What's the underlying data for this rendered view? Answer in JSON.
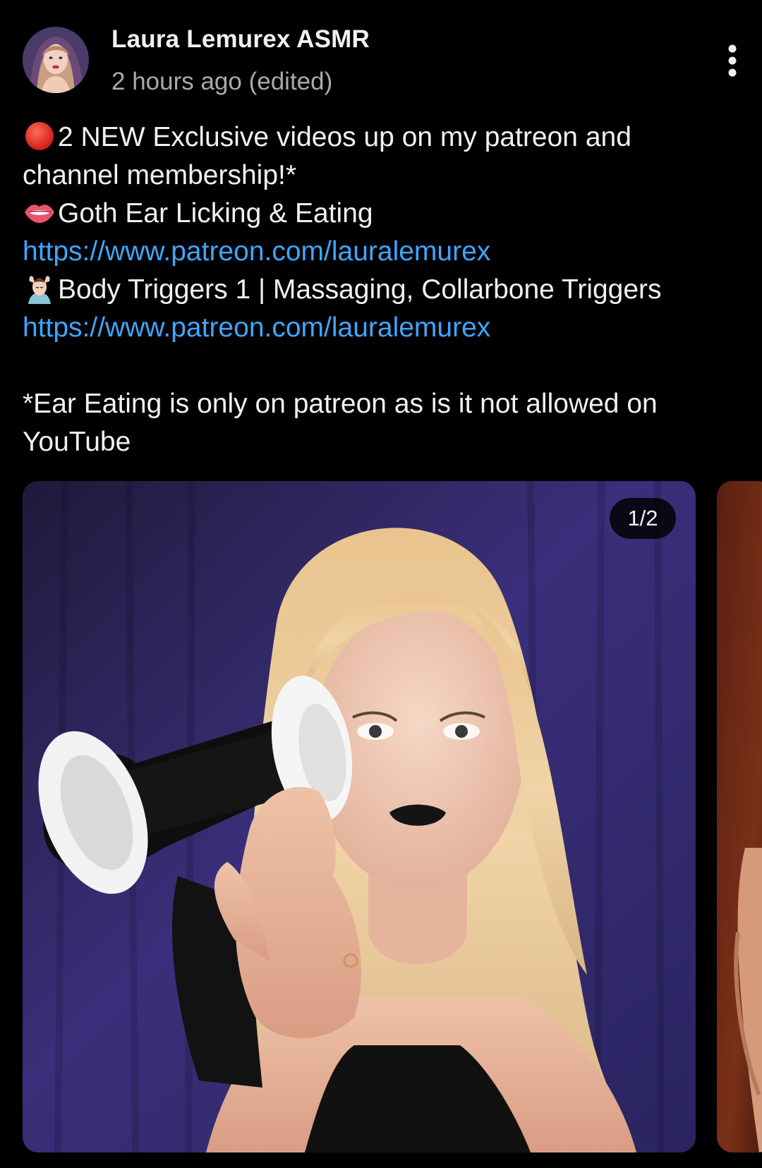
{
  "post": {
    "channel_name": "Laura Lemurex ASMR",
    "timestamp": "2 hours ago (edited)",
    "more_icon": "more-vertical-icon",
    "body": {
      "line1_emoji": "red-circle-icon",
      "line1": "2 NEW Exclusive videos up on my patreon and",
      "line2": "channel membership!*",
      "line3_emoji": "lips-icon",
      "line3": "Goth Ear Licking & Eating",
      "link1": "https://www.patreon.com/lauralemurex",
      "line5_emoji": "face-massage-icon",
      "line5": "Body Triggers 1 | Massaging, Collarbone Triggers",
      "link2": "https://www.patreon.com/lauralemurex",
      "line7": "*Ear Eating is only on patreon as is it not allowed on",
      "line8": "YouTube"
    },
    "carousel": {
      "counter": "1/2",
      "current_index": 1,
      "total": 2
    }
  },
  "colors": {
    "background": "#000000",
    "text": "#f1f1f1",
    "secondary_text": "#aaaaaa",
    "link": "#3ea6ff"
  }
}
